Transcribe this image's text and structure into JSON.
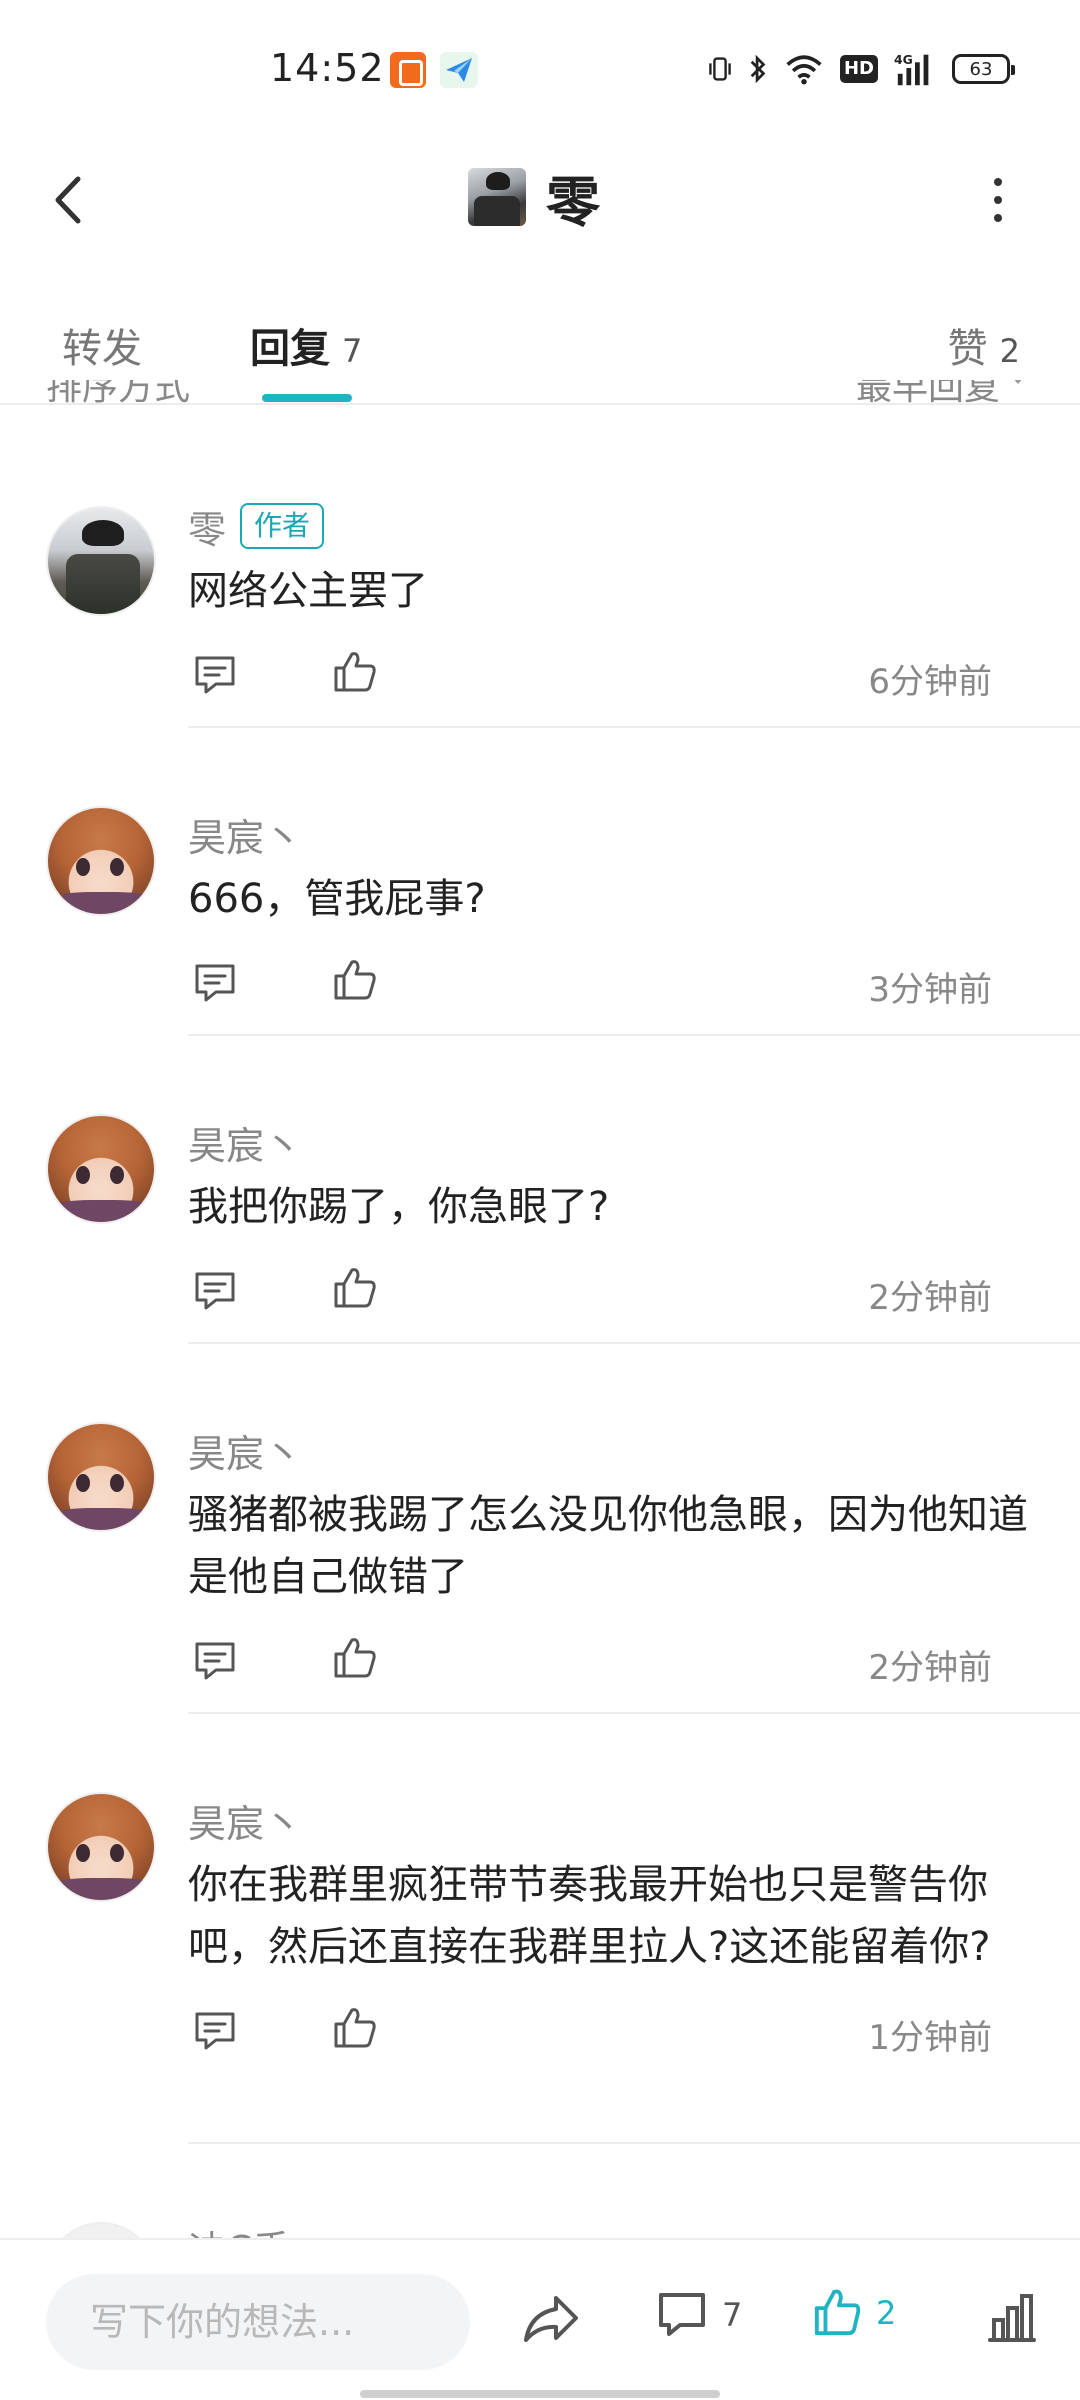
{
  "status_bar": {
    "time": "14:52",
    "hd": "HD",
    "network": "4G",
    "battery": "63"
  },
  "header": {
    "title": "零"
  },
  "tabs": {
    "forward": "转发",
    "reply": "回复",
    "reply_count": "7",
    "like": "赞",
    "like_count": "2",
    "accent_color": "#20b4c3"
  },
  "sort": {
    "label": "排序方式",
    "value": "最早回复"
  },
  "comments": [
    {
      "name": "零",
      "badge": "作者",
      "avatar": "user-photo-avatar",
      "text": "网络公主罢了",
      "time": "6分钟前"
    },
    {
      "name": "昊宸丶",
      "avatar": "anime-girl-avatar",
      "text": "666，管我屁事?",
      "time": "3分钟前"
    },
    {
      "name": "昊宸丶",
      "avatar": "anime-girl-avatar",
      "text": "我把你踢了，你急眼了?",
      "time": "2分钟前"
    },
    {
      "name": "昊宸丶",
      "avatar": "anime-girl-avatar",
      "text": "骚猪都被我踢了怎么没见你他急眼，因为他知道是他自己做错了",
      "time": "2分钟前"
    },
    {
      "name": "昊宸丶",
      "avatar": "anime-girl-avatar",
      "text": "你在我群里疯狂带节奏我最开始也只是警告你吧，然后还直接在我群里拉人?这还能留着你?",
      "time": "1分钟前"
    },
    {
      "name": "迪C手",
      "avatar": "avatar",
      "text": "",
      "time": ""
    }
  ],
  "bottom_bar": {
    "input_placeholder": "写下你的想法...",
    "comment_count": "7",
    "like_count": "2",
    "like_color": "#20b4c3"
  }
}
